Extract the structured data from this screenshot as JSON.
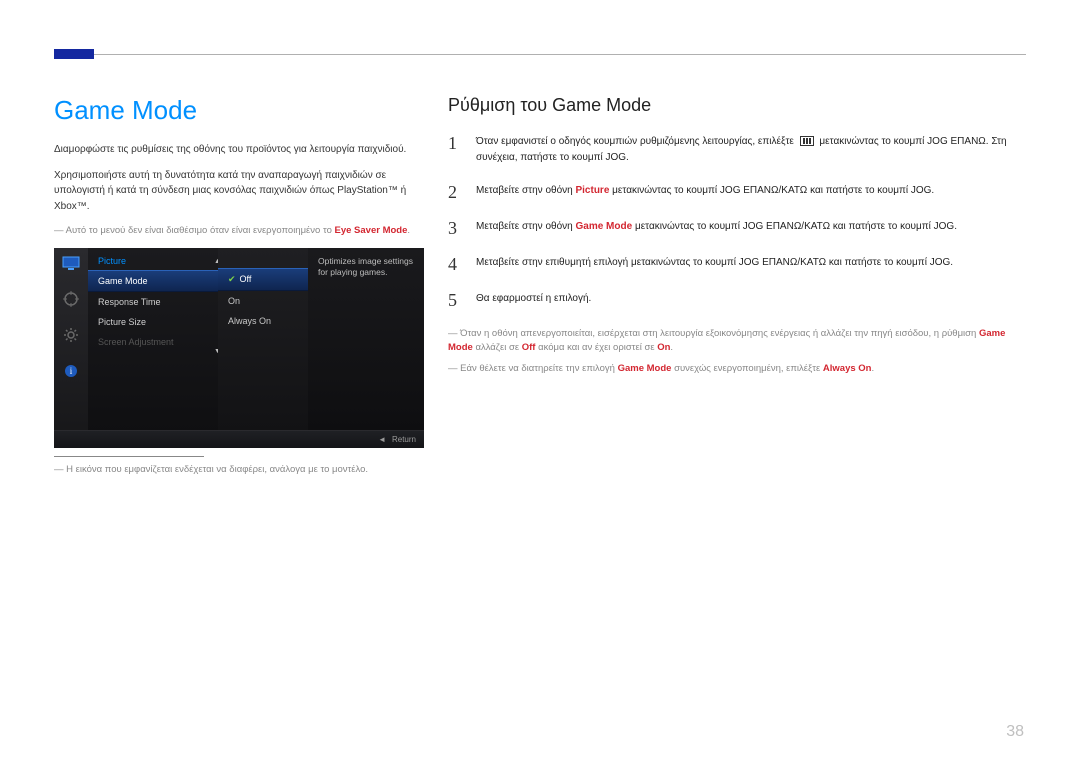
{
  "page_number": "38",
  "left": {
    "title": "Game Mode",
    "p1": "Διαμορφώστε τις ρυθμίσεις της οθόνης του προϊόντος για λειτουργία παιχνιδιού.",
    "p2": "Χρησιμοποιήστε αυτή τη δυνατότητα κατά την αναπαραγωγή παιχνιδιών σε υπολογιστή ή κατά τη σύνδεση μιας κονσόλας παιχνιδιών όπως PlayStation™ ή Xbox™.",
    "note_prefix": "Αυτό το μενού δεν είναι διαθέσιμο όταν είναι ενεργοποιημένο το ",
    "note_red": "Eye Saver Mode",
    "note_suffix": ".",
    "caption_prefix": "Η εικόνα που εμφανίζεται ενδέχεται να διαφέρει, ανάλογα με το μοντέλο."
  },
  "osd": {
    "menu_title": "Picture",
    "items": [
      "Game Mode",
      "Response Time",
      "Picture Size",
      "Screen Adjustment"
    ],
    "values": [
      "Off",
      "On",
      "Always On"
    ],
    "description": "Optimizes image settings for playing games.",
    "footer_label": "Return"
  },
  "right": {
    "title": "Ρύθμιση του Game Mode",
    "steps": {
      "s1a": "Όταν εμφανιστεί ο οδηγός κουμπιών ρυθμιζόμενης λειτουργίας, επιλέξτε",
      "s1b": "μετακινώντας το κουμπί JOG ΕΠΑΝΩ. Στη συνέχεια, πατήστε το κουμπί JOG.",
      "s2a": "Μεταβείτε στην οθόνη ",
      "s2_red": "Picture",
      "s2b": " μετακινώντας το κουμπί JOG ΕΠΑΝΩ/ΚΑΤΩ και πατήστε το κουμπί JOG.",
      "s3a": "Μεταβείτε στην οθόνη ",
      "s3_red": "Game Mode",
      "s3b": " μετακινώντας το κουμπί JOG ΕΠΑΝΩ/ΚΑΤΩ και πατήστε το κουμπί JOG.",
      "s4": "Μεταβείτε στην επιθυμητή επιλογή μετακινώντας το κουμπί JOG ΕΠΑΝΩ/ΚΑΤΩ και πατήστε το κουμπί JOG.",
      "s5": "Θα εφαρμοστεί η επιλογή."
    },
    "note1_a": "Όταν η οθόνη απενεργοποιείται, εισέρχεται στη λειτουργία εξοικονόμησης ενέργειας ή αλλάζει την πηγή εισόδου, η ρύθμιση ",
    "note1_red1": "Game Mode",
    "note1_b": " αλλάζει σε ",
    "note1_red2": "Off",
    "note1_c": " ακόμα και αν έχει οριστεί σε ",
    "note1_red3": "On",
    "note1_d": ".",
    "note2_a": "Εάν θέλετε να διατηρείτε την επιλογή ",
    "note2_red1": "Game Mode",
    "note2_b": " συνεχώς ενεργοποιημένη, επιλέξτε ",
    "note2_red2": "Always On",
    "note2_c": "."
  }
}
